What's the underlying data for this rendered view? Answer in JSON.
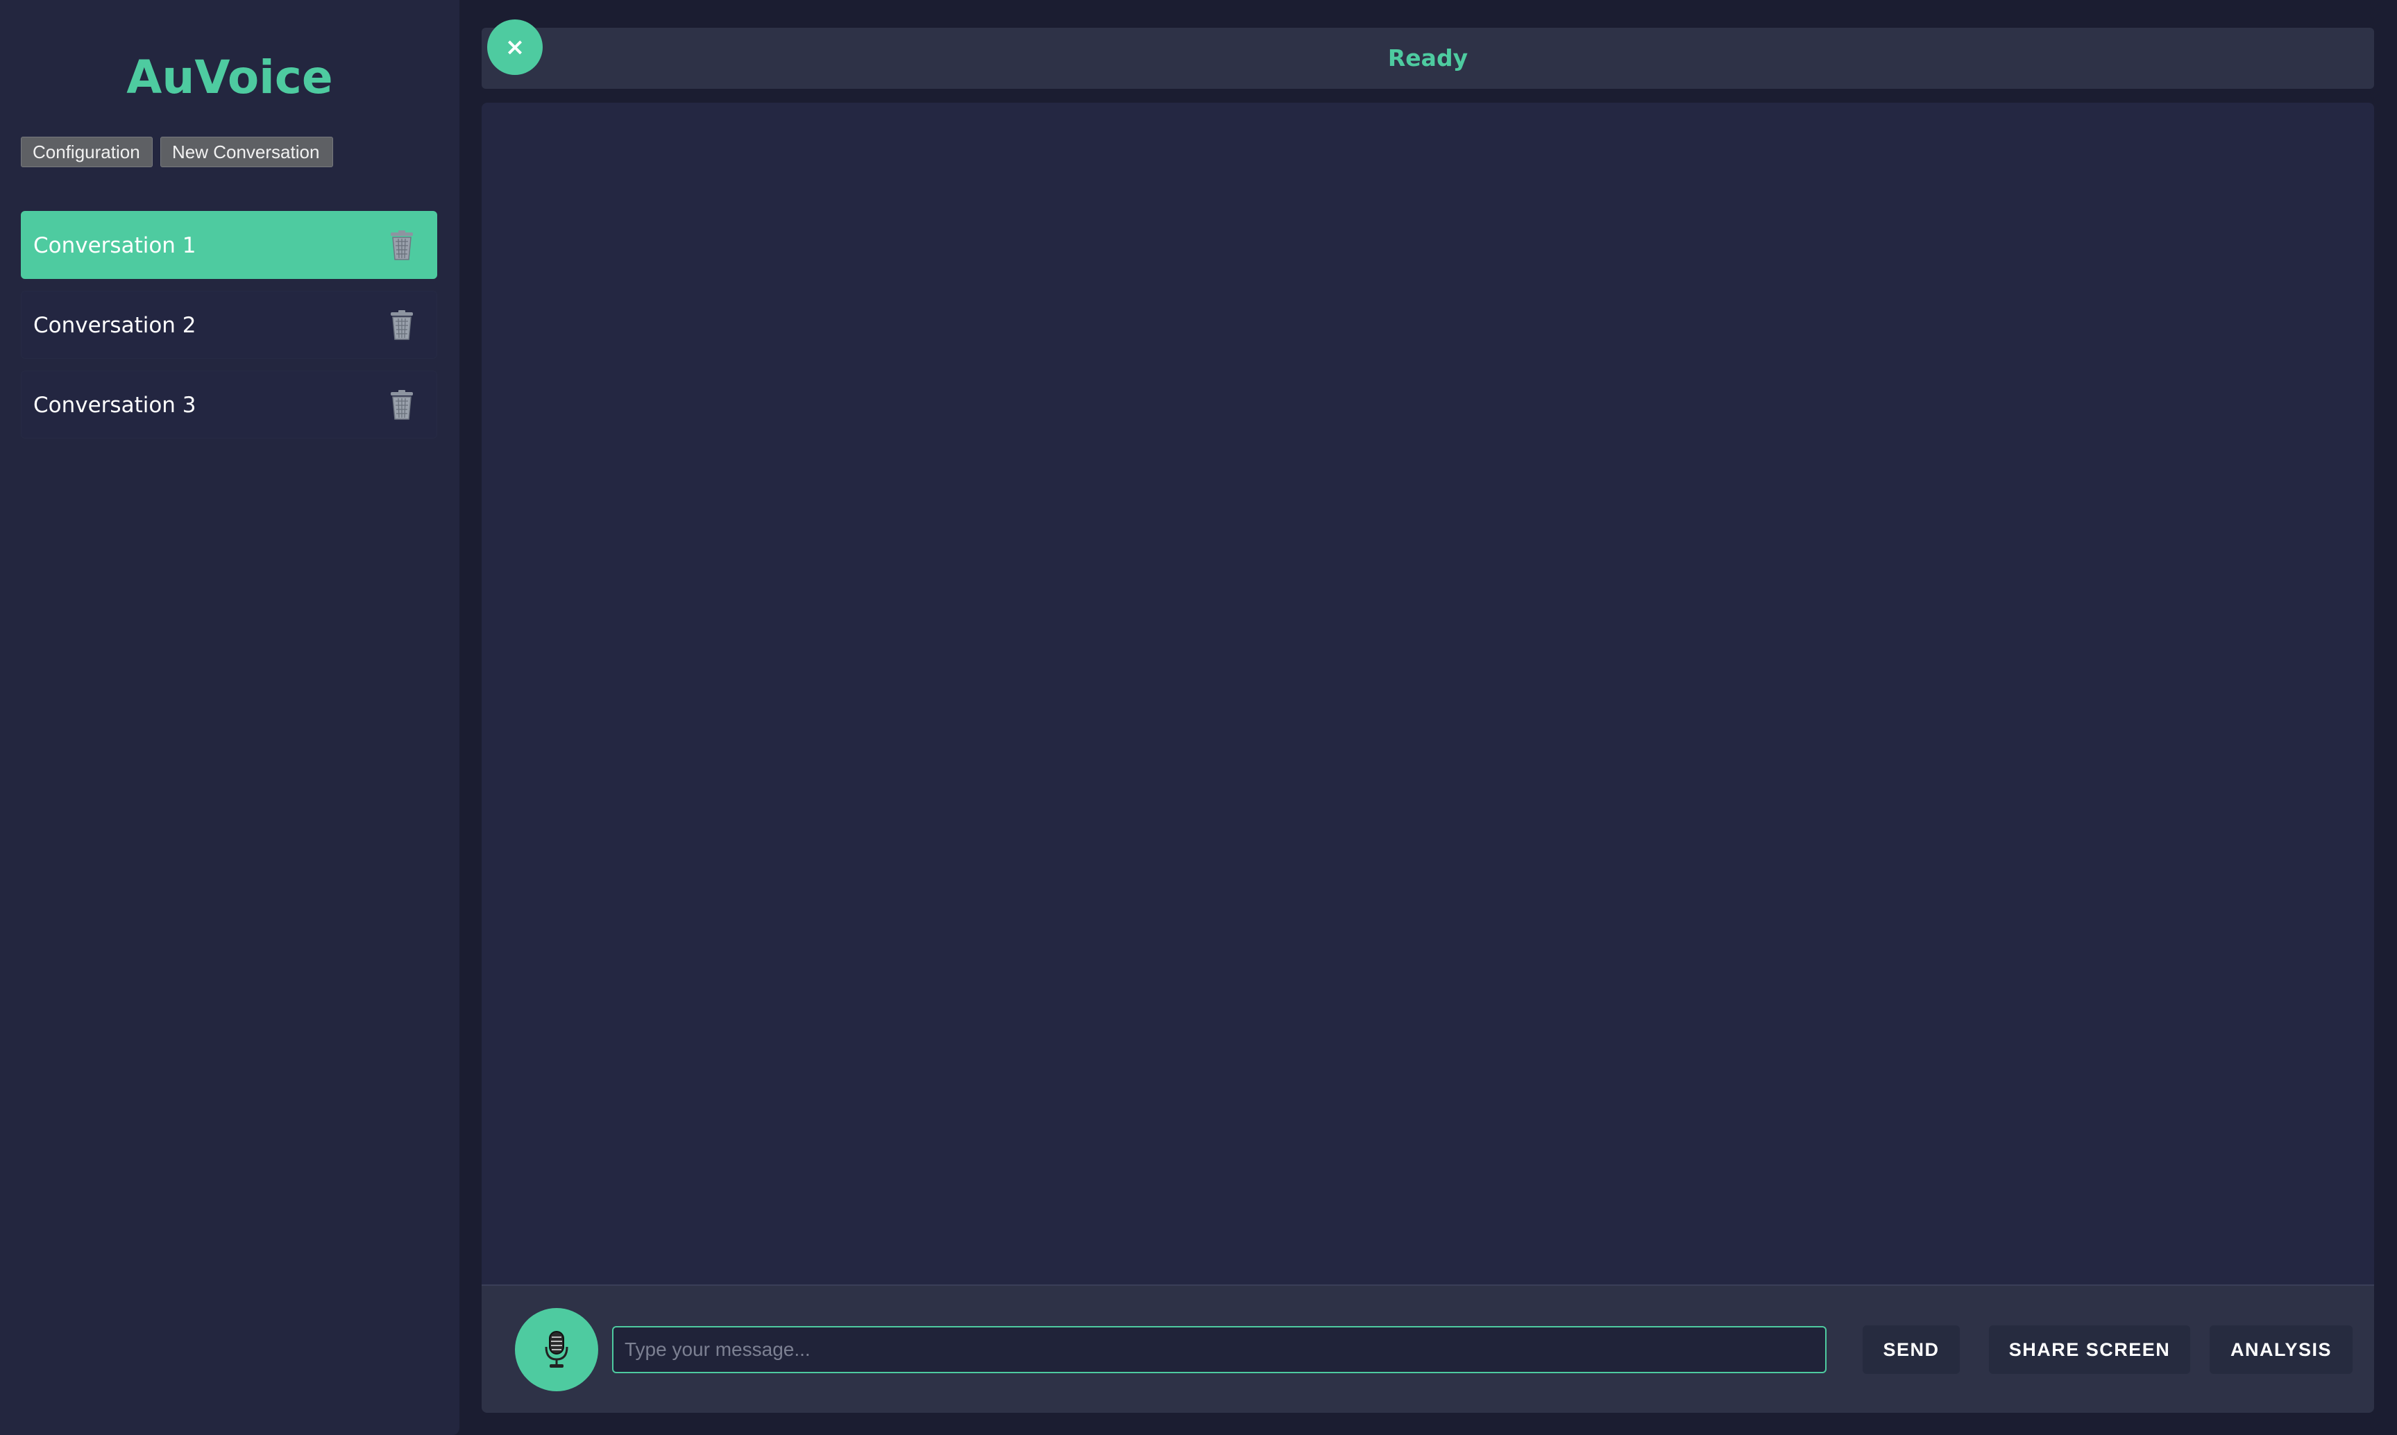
{
  "app": {
    "title": "AuVoice"
  },
  "sidebar": {
    "configuration_label": "Configuration",
    "new_conversation_label": "New Conversation",
    "conversations": [
      {
        "label": "Conversation 1",
        "active": true
      },
      {
        "label": "Conversation 2",
        "active": false
      },
      {
        "label": "Conversation 3",
        "active": false
      }
    ]
  },
  "header": {
    "status": "Ready",
    "close_symbol": "×"
  },
  "composer": {
    "placeholder": "Type your message...",
    "value": "",
    "send_label": "SEND",
    "share_screen_label": "SHARE SCREEN",
    "analysis_label": "ANALYSIS"
  },
  "icons": {
    "close": "close-icon",
    "delete": "trash-icon",
    "microphone": "microphone-icon"
  },
  "colors": {
    "accent": "#4ecba0",
    "background": "#1b1d31",
    "sidebar": "#23263f",
    "panel": "#242742",
    "bar": "#2e3247"
  }
}
